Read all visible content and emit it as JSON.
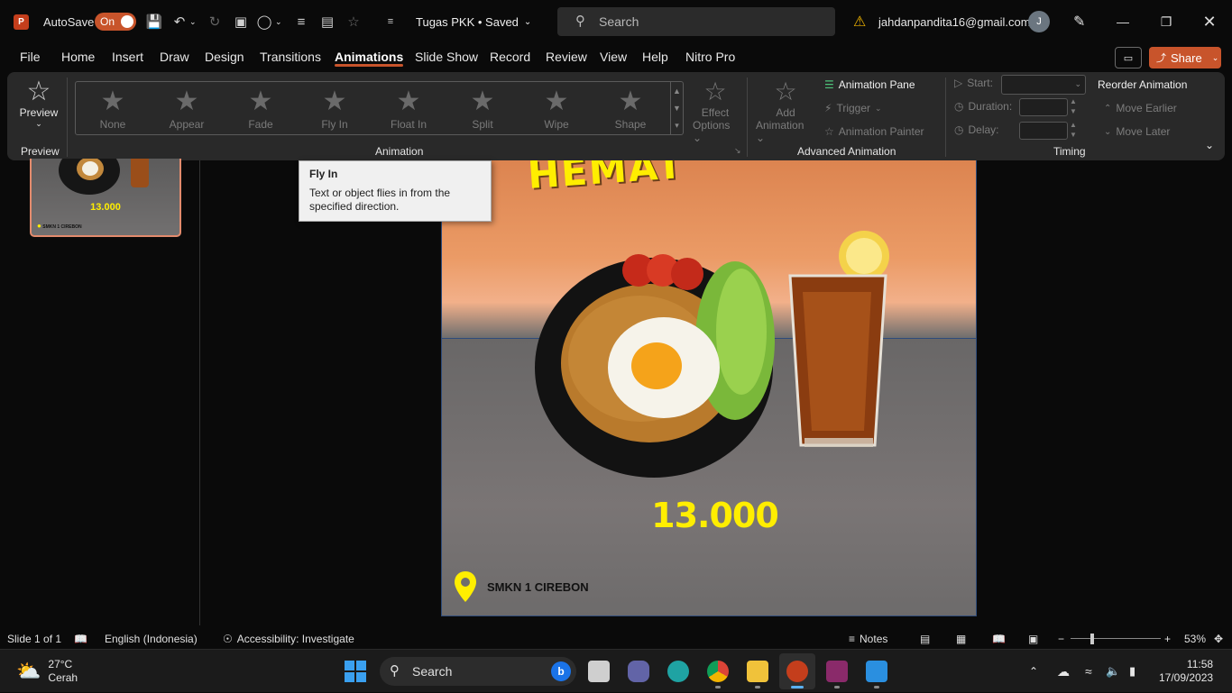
{
  "titlebar": {
    "autosave_label": "AutoSave",
    "autosave_state": "On",
    "doc_title": "Tugas PKK • Saved",
    "search_placeholder": "Search",
    "account_email": "jahdanpandita16@gmail.com",
    "avatar_initial": "J"
  },
  "menu": {
    "tabs": [
      "File",
      "Home",
      "Insert",
      "Draw",
      "Design",
      "Transitions",
      "Animations",
      "Slide Show",
      "Record",
      "Review",
      "View",
      "Help",
      "Nitro Pro"
    ],
    "active_tab": "Animations",
    "share_label": "Share"
  },
  "ribbon": {
    "preview": {
      "button_label": "Preview",
      "group_label": "Preview"
    },
    "animation_group_label": "Animation",
    "animations": [
      "None",
      "Appear",
      "Fade",
      "Fly In",
      "Float In",
      "Split",
      "Wipe",
      "Shape"
    ],
    "effect_options": [
      "Effect",
      "Options"
    ],
    "advanced": {
      "add_animation": [
        "Add",
        "Animation"
      ],
      "animation_pane": "Animation Pane",
      "trigger": "Trigger",
      "animation_painter": "Animation Painter",
      "group_label": "Advanced Animation"
    },
    "timing": {
      "start_label": "Start:",
      "duration_label": "Duration:",
      "delay_label": "Delay:",
      "reorder_label": "Reorder Animation",
      "move_earlier": "Move Earlier",
      "move_later": "Move Later",
      "group_label": "Timing"
    }
  },
  "tooltip": {
    "title": "Fly In",
    "body": "Text or object flies in from the specified direction."
  },
  "slide": {
    "heading_text": "HEMAT",
    "price": "13.000",
    "location": "SMKN 1 CIREBON"
  },
  "thumbnail": {
    "price": "13.000",
    "location": "SMKN 1 CIREBON"
  },
  "statusbar": {
    "slide_info": "Slide 1 of 1",
    "language": "English (Indonesia)",
    "accessibility": "Accessibility: Investigate",
    "notes": "Notes",
    "zoom": "53%",
    "zoom_level": 0.53
  },
  "taskbar": {
    "weather_temp": "27°C",
    "weather_desc": "Cerah",
    "search_label": "Search",
    "time": "11:58",
    "date": "17/09/2023"
  },
  "colors": {
    "accent": "#c8542b",
    "price_yellow": "#ffee00",
    "ribbon_bg": "#292929"
  }
}
